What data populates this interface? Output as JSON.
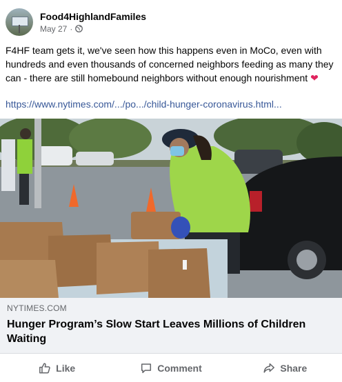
{
  "post": {
    "page_name": "Food4HighlandFamiles",
    "date": "May 27",
    "separator": "·",
    "privacy_icon": "globe-icon",
    "text": "F4HF team gets it, we've seen how this happens even in MoCo, even with hundreds and even thousands of concerned neighbors feeding as many they can - there are still homebound neighbors without enough nourishment",
    "emoji": "❤",
    "link_text": "https://www.nytimes.com/.../po.../child-hunger-coronavirus.html..."
  },
  "preview": {
    "source": "NYTIMES.COM",
    "headline": "Hunger Program’s Slow Start Leaves Millions of Children Waiting"
  },
  "actions": [
    {
      "label": "Like",
      "icon": "thumbs-up-icon"
    },
    {
      "label": "Comment",
      "icon": "comment-icon"
    },
    {
      "label": "Share",
      "icon": "share-icon"
    }
  ],
  "colors": {
    "link": "#385898",
    "meta": "#65676b",
    "heart": "#e0245e",
    "preview_bg": "#f0f2f5"
  }
}
